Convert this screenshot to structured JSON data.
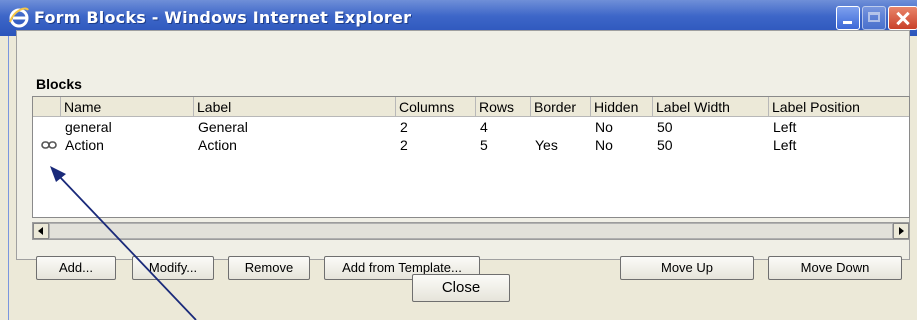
{
  "window": {
    "title": "Form Blocks - Windows Internet Explorer",
    "titlebar_color": "#3d66c8"
  },
  "blocks": {
    "title": "Blocks",
    "columns": [
      "Name",
      "Label",
      "Columns",
      "Rows",
      "Border",
      "Hidden",
      "Label Width",
      "Label Position"
    ],
    "rows": [
      {
        "icon": "",
        "name": "general",
        "label": "General",
        "columns": "2",
        "rows": "4",
        "border": "",
        "hidden": "No",
        "label_width": "50",
        "label_position": "Left"
      },
      {
        "icon": "link-icon",
        "name": "Action",
        "label": "Action",
        "columns": "2",
        "rows": "5",
        "border": "Yes",
        "hidden": "No",
        "label_width": "50",
        "label_position": "Left"
      }
    ]
  },
  "buttons": {
    "add": "Add...",
    "modify": "Modify...",
    "remove": "Remove",
    "add_from_template": "Add from Template...",
    "move_up": "Move Up",
    "move_down": "Move Down",
    "close": "Close"
  }
}
